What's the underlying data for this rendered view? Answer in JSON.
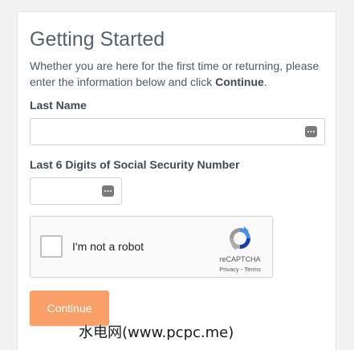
{
  "page": {
    "title": "Getting Started",
    "intro_text": "Whether you are here for the first time or returning, please enter the information below and click ",
    "intro_emphasis": "Continue",
    "intro_end": "."
  },
  "form": {
    "last_name": {
      "label": "Last Name",
      "value": "",
      "icon": "password-manager-icon"
    },
    "ssn_last6": {
      "label": "Last 6 Digits of Social Security Number",
      "value": "",
      "icon": "password-manager-icon"
    }
  },
  "recaptcha": {
    "checkbox_label": "I'm not a robot",
    "checked": false,
    "brand": "reCAPTCHA",
    "links": "Privacy - Terms"
  },
  "actions": {
    "continue_label": "Continue",
    "continue_color": "#f8a068"
  },
  "watermark": "水电网(www.pcpc.me)"
}
